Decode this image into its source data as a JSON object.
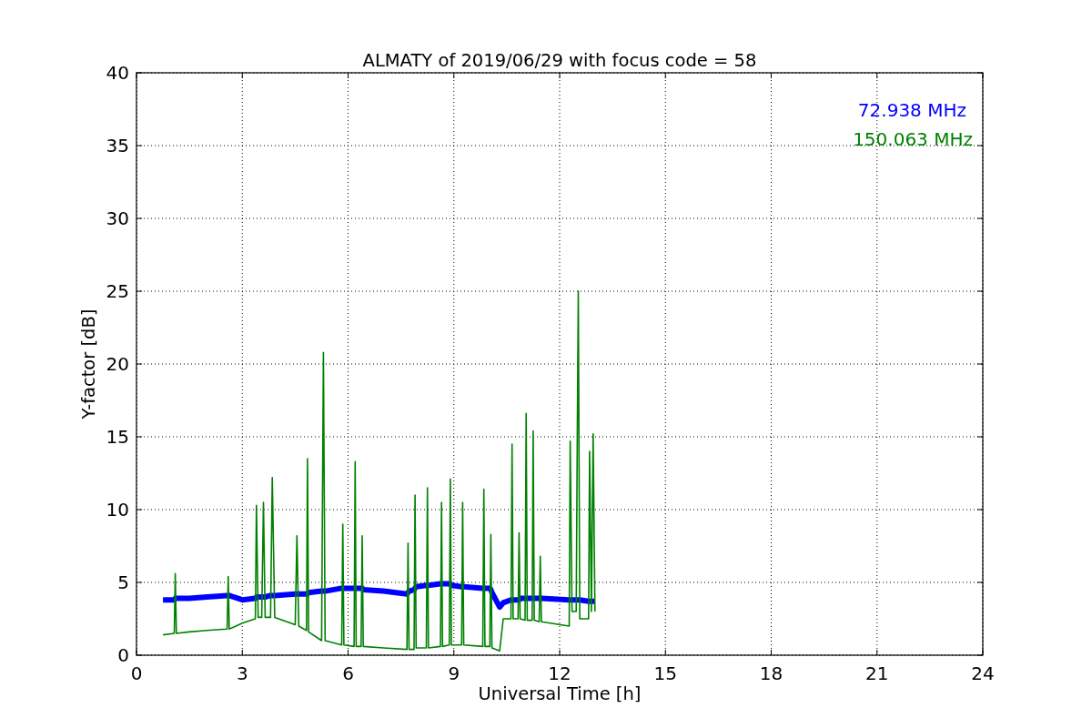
{
  "chart": {
    "chart_data": {
      "type": "line",
      "title": "ALMATY of 2019/06/29 with focus code = 58",
      "xlabel": "Universal Time [h]",
      "ylabel": "Y-factor [dB]",
      "xlim": [
        0,
        24
      ],
      "ylim": [
        0,
        40
      ],
      "xticks": [
        0,
        3,
        6,
        9,
        12,
        15,
        18,
        21,
        24
      ],
      "yticks": [
        0,
        5,
        10,
        15,
        20,
        25,
        30,
        35,
        40
      ],
      "grid": true,
      "x": [
        0.75,
        1.07,
        1.1,
        1.13,
        1.5,
        2.0,
        2.57,
        2.6,
        2.63,
        3.0,
        3.37,
        3.4,
        3.45,
        3.55,
        3.6,
        3.65,
        3.8,
        3.85,
        3.92,
        4.5,
        4.55,
        4.6,
        4.82,
        4.85,
        4.88,
        5.25,
        5.3,
        5.35,
        5.82,
        5.85,
        5.88,
        6.17,
        6.2,
        6.23,
        6.37,
        6.4,
        6.43,
        7.0,
        7.67,
        7.7,
        7.73,
        7.87,
        7.9,
        7.93,
        8.22,
        8.25,
        8.28,
        8.62,
        8.65,
        8.68,
        8.87,
        8.9,
        8.93,
        9.22,
        9.25,
        9.28,
        9.82,
        9.85,
        9.88,
        10.02,
        10.05,
        10.08,
        10.3,
        10.4,
        10.62,
        10.65,
        10.68,
        10.82,
        10.85,
        10.88,
        11.02,
        11.05,
        11.08,
        11.22,
        11.25,
        11.28,
        11.42,
        11.45,
        11.48,
        12.27,
        12.3,
        12.35,
        12.47,
        12.5,
        12.53,
        12.57,
        12.82,
        12.85,
        12.9,
        12.95,
        13.0
      ],
      "series": [
        {
          "name": "72.938 MHz",
          "color": "#0000ff",
          "values": [
            3.8,
            3.8,
            3.9,
            3.9,
            3.9,
            4.0,
            4.1,
            4.1,
            4.1,
            3.8,
            3.9,
            4.0,
            4.0,
            4.0,
            4.0,
            4.0,
            4.1,
            4.1,
            4.1,
            4.2,
            4.2,
            4.2,
            4.2,
            4.2,
            4.3,
            4.4,
            4.4,
            4.4,
            4.6,
            4.6,
            4.6,
            4.6,
            4.6,
            4.6,
            4.6,
            4.6,
            4.5,
            4.4,
            4.2,
            4.3,
            4.4,
            4.5,
            4.6,
            4.7,
            4.8,
            4.8,
            4.8,
            4.9,
            4.9,
            4.9,
            4.9,
            4.9,
            4.8,
            4.7,
            4.7,
            4.7,
            4.6,
            4.6,
            4.6,
            4.6,
            4.5,
            4.3,
            3.3,
            3.6,
            3.8,
            3.8,
            3.8,
            3.8,
            3.8,
            3.9,
            3.9,
            3.9,
            3.9,
            3.9,
            3.9,
            3.9,
            3.9,
            3.9,
            3.9,
            3.8,
            3.8,
            3.8,
            3.8,
            3.8,
            3.8,
            3.8,
            3.7,
            3.7,
            3.7,
            3.7,
            3.7
          ]
        },
        {
          "name": "150.063 MHz",
          "color": "#008000",
          "values": [
            1.4,
            1.5,
            5.6,
            1.5,
            1.6,
            1.7,
            1.8,
            5.4,
            1.8,
            2.2,
            2.5,
            10.3,
            2.6,
            2.6,
            10.5,
            2.6,
            2.6,
            12.2,
            2.6,
            2.1,
            8.2,
            2.0,
            1.7,
            13.5,
            1.6,
            1.0,
            20.8,
            1.0,
            0.7,
            9.0,
            0.7,
            0.6,
            13.3,
            0.6,
            0.6,
            8.2,
            0.6,
            0.5,
            0.4,
            7.7,
            0.4,
            0.4,
            11.0,
            0.5,
            0.5,
            11.5,
            0.5,
            0.6,
            10.5,
            0.6,
            0.7,
            12.1,
            0.7,
            0.7,
            10.5,
            0.7,
            0.6,
            11.4,
            0.6,
            0.6,
            8.3,
            0.5,
            0.3,
            2.5,
            2.5,
            14.5,
            2.5,
            2.5,
            8.4,
            2.5,
            2.4,
            16.6,
            2.4,
            2.4,
            15.4,
            2.4,
            2.3,
            6.8,
            2.3,
            2.0,
            14.7,
            3.0,
            3.0,
            15.2,
            25.0,
            2.5,
            2.5,
            14.0,
            3.0,
            15.2,
            3.0
          ]
        }
      ]
    }
  }
}
